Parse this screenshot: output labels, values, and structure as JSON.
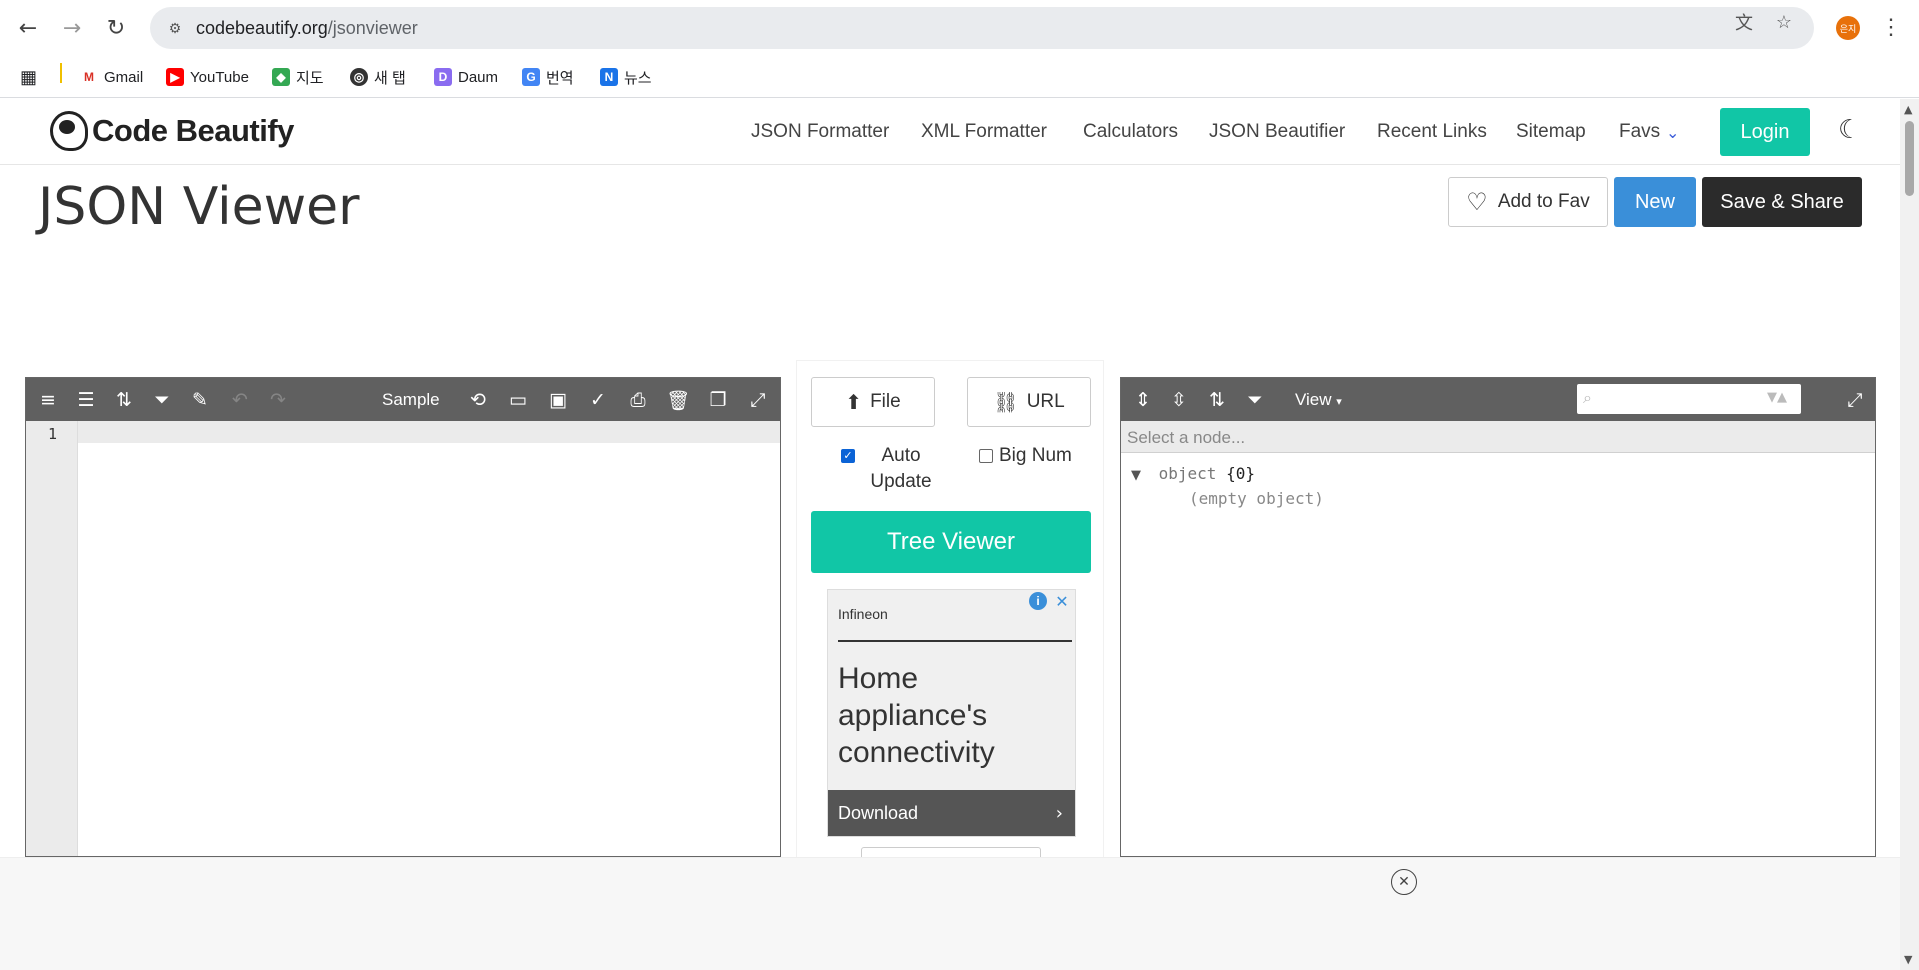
{
  "browser": {
    "url_host": "codebeautify.org",
    "url_path": "/jsonviewer",
    "profile_initials": "은지",
    "bookmarks": [
      {
        "label": "Gmail",
        "icon": "gmail-icon"
      },
      {
        "label": "YouTube",
        "icon": "youtube-icon"
      },
      {
        "label": "지도",
        "icon": "maps-icon"
      },
      {
        "label": "새 탭",
        "icon": "globe-icon"
      },
      {
        "label": "Daum",
        "icon": "daum-icon"
      },
      {
        "label": "번역",
        "icon": "translate-icon"
      },
      {
        "label": "뉴스",
        "icon": "news-icon"
      }
    ]
  },
  "site": {
    "logo_text": "Code Beautify",
    "nav": [
      "JSON Formatter",
      "XML Formatter",
      "Calculators",
      "JSON Beautifier",
      "Recent Links",
      "Sitemap",
      "Favs"
    ],
    "login": "Login"
  },
  "page": {
    "title": "JSON Viewer",
    "add_fav": "Add to Fav",
    "new": "New",
    "save_share": "Save & Share"
  },
  "editor": {
    "sample_label": "Sample",
    "line_numbers": [
      "1"
    ]
  },
  "middle": {
    "file_label": "File",
    "url_label": "URL",
    "auto_update_label": "Auto Update",
    "auto_update_checked": true,
    "big_num_label": "Big Num",
    "big_num_checked": false,
    "tree_viewer_label": "Tree Viewer",
    "ad": {
      "brand": "Infineon",
      "headline": "Home appliance's connectivity",
      "cta": "Download"
    }
  },
  "viewer": {
    "view_label": "View",
    "breadcrumb": "Select a node...",
    "root_key": "object",
    "root_count": "{0}",
    "empty_text": "(empty object)"
  },
  "colors": {
    "accent_teal": "#11c6a6",
    "new_blue": "#3a8fd9",
    "save_dark": "#2b2b2b",
    "toolbar_gray": "#606060"
  }
}
